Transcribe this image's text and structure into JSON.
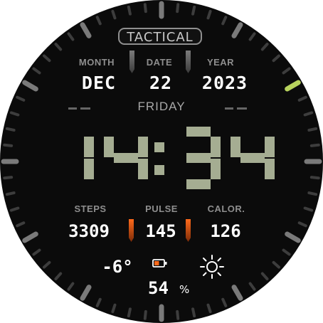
{
  "watchface": {
    "brand": "TACTICAL",
    "labels": {
      "month": "MONTH",
      "date": "DATE",
      "year": "YEAR",
      "steps": "STEPS",
      "pulse": "PULSE",
      "calories": "CALOR."
    },
    "date": {
      "month": "DEC",
      "day": "22",
      "year": "2023",
      "weekday": "FRIDAY"
    },
    "time": {
      "hours": "14",
      "minutes": "34"
    },
    "stats": {
      "steps": "3309",
      "pulse": "145",
      "calories": "126"
    },
    "weather": {
      "temperature": "-6°",
      "icon": "sun-icon"
    },
    "battery": {
      "percent_text": "54",
      "percent_symbol": "%",
      "level": 0.54,
      "icon": "battery-icon"
    },
    "colors": {
      "background": "#0b0b0b",
      "digit": "#a5ad92",
      "accent_orange": "#ff6a1b",
      "accent_green": "#b7d35d"
    }
  }
}
